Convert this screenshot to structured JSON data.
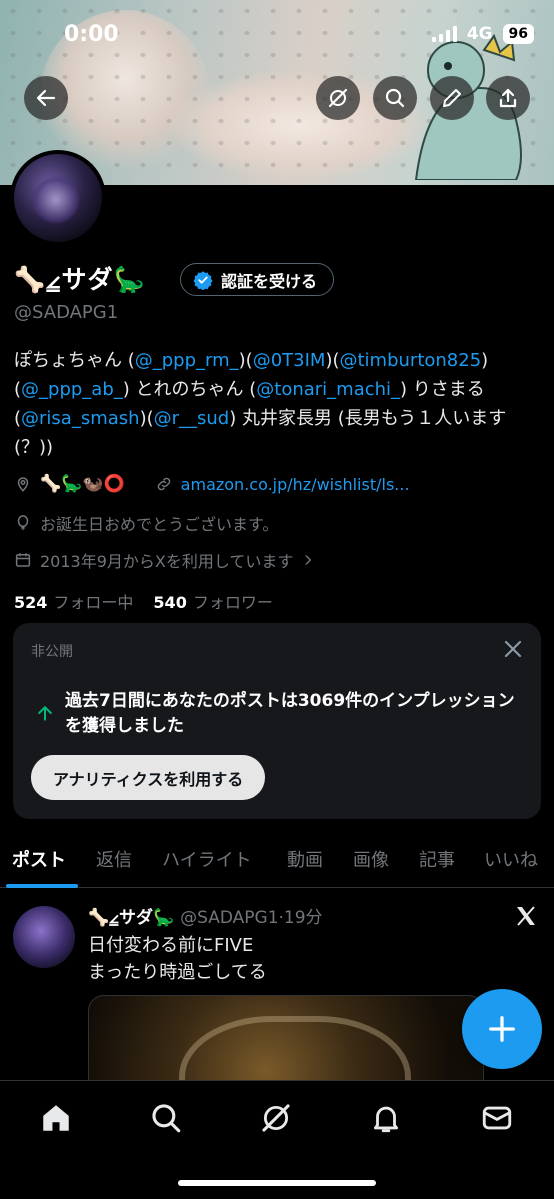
{
  "status_bar": {
    "time": "0:00",
    "network": "4G",
    "battery": "96"
  },
  "profile": {
    "name": "🦴⦤サダ🦕",
    "handle": "@SADAPG1",
    "verify_button": "認証を受ける",
    "bio": {
      "t1": "ぽちょちゃん (",
      "l1": "@_ppp_rm_",
      "t2": ")(",
      "l2": "@0T3IM",
      "t3": ")(",
      "l3": "@timburton825",
      "t4": ")(",
      "l4": "@_ppp_ab_",
      "t5": ") とれのちゃん (",
      "l5": "@tonari_machi_",
      "t6": ") りさまる (",
      "l6": "@risa_smash",
      "t7": ")(",
      "l7": "@r__sud",
      "t8": ") 丸井家長男 (長男もう１人います(？))"
    },
    "location_emojis": "🦴🦕🦦⭕",
    "website": "amazon.co.jp/hz/wishlist/ls...",
    "birthday": "お誕生日おめでとうございます。",
    "joined": "2013年9月からXを利用しています",
    "following_count": "524",
    "following_label": "フォロー中",
    "followers_count": "540",
    "followers_label": "フォロワー"
  },
  "private_card": {
    "title": "非公開",
    "text": "過去7日間にあなたのポストは3069件のインプレッションを獲得しました",
    "button": "アナリティクスを利用する"
  },
  "tabs": [
    "ポスト",
    "返信",
    "ハイライト",
    "動画",
    "画像",
    "記事",
    "いいね"
  ],
  "post": {
    "name": "🦴⦤サダ🦕",
    "handle_time": "@SADAPG1·19分",
    "line1": "日付変わる前にFIVE",
    "line2": "まったり時過ごしてる"
  },
  "colors": {
    "accent": "#1d9bf0",
    "background": "#000000",
    "muted": "#71767b"
  }
}
